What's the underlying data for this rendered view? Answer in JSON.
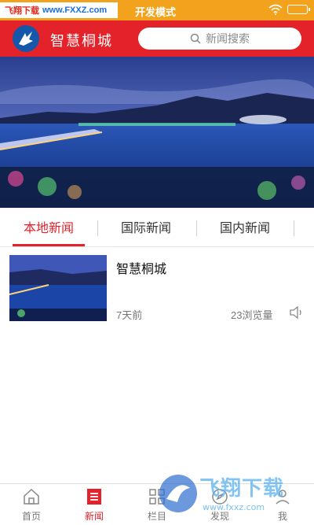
{
  "status_bar": {
    "watermark_left": "飞翔下载",
    "watermark_url": "www.FXXZ.com",
    "title": "开发模式",
    "icons": [
      "wifi-icon",
      "battery-icon"
    ],
    "color": "#f2a21c"
  },
  "header": {
    "title": "智慧桐城",
    "search_placeholder": "新闻搜索",
    "color": "#e3222a"
  },
  "tabs": [
    {
      "label": "本地新闻",
      "active": true
    },
    {
      "label": "国际新闻",
      "active": false
    },
    {
      "label": "国内新闻",
      "active": false
    }
  ],
  "news": [
    {
      "title": "智慧桐城",
      "time": "7天前",
      "views": "23浏览量",
      "icon": "speaker-icon"
    }
  ],
  "bottom_nav": [
    {
      "label": "首页",
      "icon": "home-icon",
      "active": false
    },
    {
      "label": "新闻",
      "icon": "news-icon",
      "active": true
    },
    {
      "label": "栏目",
      "icon": "grid-icon",
      "active": false
    },
    {
      "label": "发现",
      "icon": "discover-icon",
      "active": false
    },
    {
      "label": "我",
      "icon": "user-icon",
      "active": false
    }
  ],
  "watermark": {
    "text": "飞翔下载",
    "url": "www.fxxz.com"
  }
}
